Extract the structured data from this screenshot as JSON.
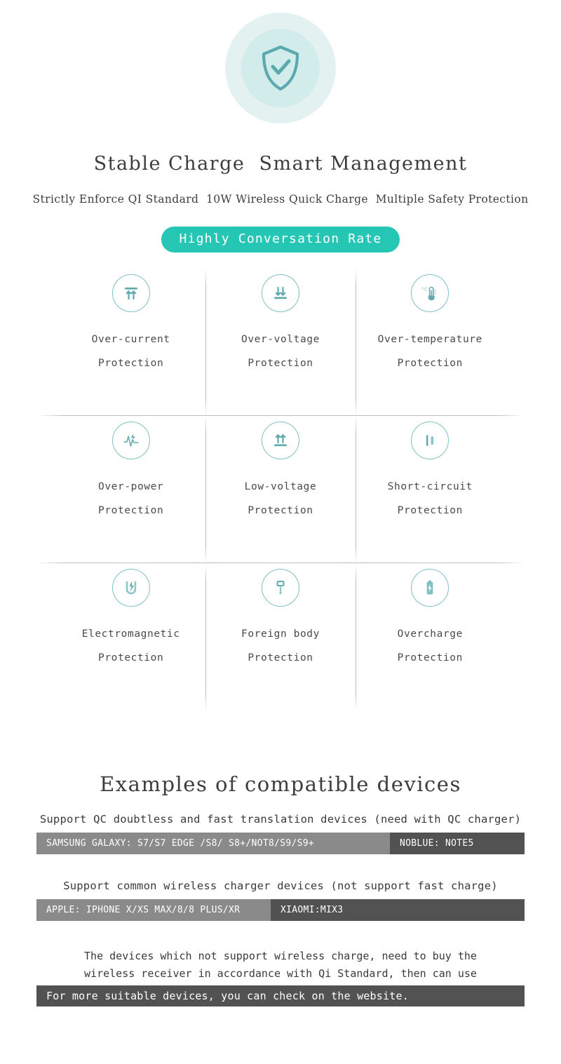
{
  "hero": {
    "icon": "shield-check-icon"
  },
  "headline": "Stable Charge  Smart Management",
  "subhead": "Strictly Enforce QI Standard  10W Wireless Quick Charge  Multiple Safety Protection",
  "badge": "Highly Conversation Rate",
  "features": [
    {
      "icon": "over-current-icon",
      "line1": "Over-current",
      "line2": "Protection"
    },
    {
      "icon": "over-voltage-icon",
      "line1": "Over-voltage",
      "line2": "Protection"
    },
    {
      "icon": "thermometer-icon",
      "line1": "Over-temperature",
      "line2": "Protection"
    },
    {
      "icon": "over-power-icon",
      "line1": "Over-power",
      "line2": "Protection"
    },
    {
      "icon": "low-voltage-icon",
      "line1": "Low-voltage",
      "line2": "Protection"
    },
    {
      "icon": "short-circuit-icon",
      "line1": "Short-circuit",
      "line2": "Protection"
    },
    {
      "icon": "magnet-icon",
      "line1": "Electromagnetic",
      "line2": "Protection"
    },
    {
      "icon": "key-icon",
      "line1": "Foreign body",
      "line2": "Protection"
    },
    {
      "icon": "battery-charge-icon",
      "line1": "Overcharge",
      "line2": "Protection"
    }
  ],
  "compat": {
    "title": "Examples of compatible devices",
    "sub1": "Support QC doubtless and fast translation devices (need with QC charger)",
    "row1": {
      "left": "SAMSUNG GALAXY: S7/S7 EDGE /S8/ S8+/NOT8/S9/S9+",
      "right": "NOBLUE: NOTE5"
    },
    "sub2": "Support common wireless charger devices (not support fast charge)",
    "row2": {
      "left": "APPLE: IPHONE X/XS MAX/8/8 PLUS/XR",
      "right": "XIAOMI:MIX3"
    },
    "note_line1": "The devices which not support wireless charge, need to buy the",
    "note_line2": "wireless receiver in accordance with Qi Standard, then can use",
    "note_bar": "For more suitable devices, you can check on the website."
  },
  "colors": {
    "teal": "#26c6b4",
    "icon_teal": "#5fa9ad",
    "bar_light": "#8a8a8a",
    "bar_dark": "#525252",
    "hero_outer": "#e3f2f1",
    "hero_inner": "#d2eceb"
  }
}
